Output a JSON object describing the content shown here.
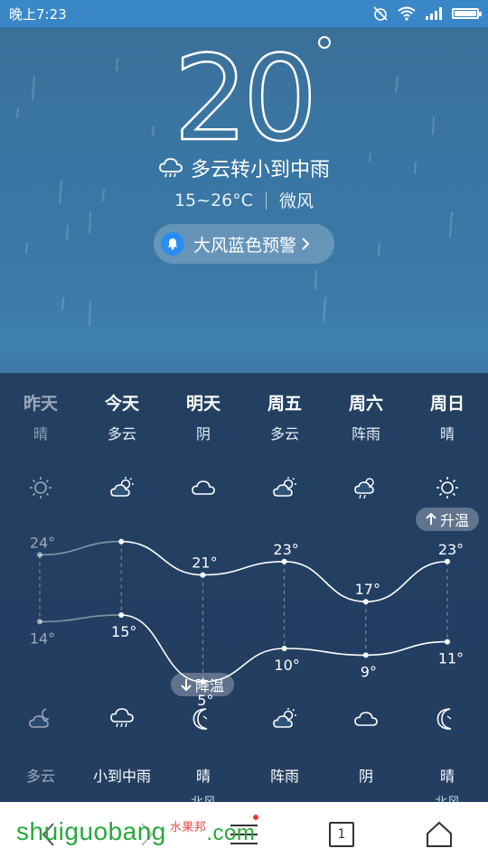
{
  "status_bar": {
    "time": "晚上7:23",
    "icons": [
      "alarm-off-icon",
      "wifi-icon",
      "signal-icon",
      "battery-icon"
    ]
  },
  "current": {
    "temperature": "20",
    "condition": "多云转小到中雨",
    "condition_icon": "rain-cloud-icon",
    "range": "15~26°C",
    "wind": "微风",
    "alert": "大风蓝色预警"
  },
  "forecast": {
    "days": [
      {
        "name": "昨天",
        "day_cond": "晴",
        "day_icon": "sun-icon",
        "high": "24°",
        "low": "14°",
        "night_icon": "cloudy-night-icon",
        "night_cond": "多云",
        "wind": "",
        "past": true
      },
      {
        "name": "今天",
        "day_cond": "多云",
        "day_icon": "partly-cloudy-icon",
        "high": "26°",
        "low": "15°",
        "night_icon": "rain-cloud-icon",
        "night_cond": "小到中雨",
        "wind": "",
        "past": false
      },
      {
        "name": "明天",
        "day_cond": "阴",
        "day_icon": "cloud-icon",
        "high": "21°",
        "low": "5°",
        "night_icon": "moon-icon",
        "night_cond": "晴",
        "wind": "北风",
        "past": false
      },
      {
        "name": "周五",
        "day_cond": "多云",
        "day_icon": "partly-cloudy-icon",
        "high": "23°",
        "low": "10°",
        "night_icon": "partly-cloudy-icon",
        "night_cond": "阵雨",
        "wind": "",
        "past": false
      },
      {
        "name": "周六",
        "day_cond": "阵雨",
        "day_icon": "shower-icon",
        "high": "17°",
        "low": "9°",
        "night_icon": "cloud-icon",
        "night_cond": "阴",
        "wind": "",
        "past": false
      },
      {
        "name": "周日",
        "day_cond": "晴",
        "day_icon": "sun-icon",
        "high": "23°",
        "low": "11°",
        "night_icon": "moon-icon",
        "night_cond": "晴",
        "wind": "北风",
        "past": false
      }
    ],
    "rise_label": "升温",
    "drop_label": "降温"
  },
  "chart_data": {
    "type": "line",
    "categories": [
      "昨天",
      "今天",
      "明天",
      "周五",
      "周六",
      "周日"
    ],
    "series": [
      {
        "name": "",
        "values": [
          24,
          26,
          21,
          23,
          17,
          23
        ]
      },
      {
        "name": "",
        "values": [
          14,
          15,
          5,
          10,
          9,
          11
        ]
      }
    ]
  },
  "nav": {
    "tab_count": "1",
    "watermark": "shuiguobang",
    "watermark_cn": "水果邦",
    "watermark_com": ".com"
  }
}
